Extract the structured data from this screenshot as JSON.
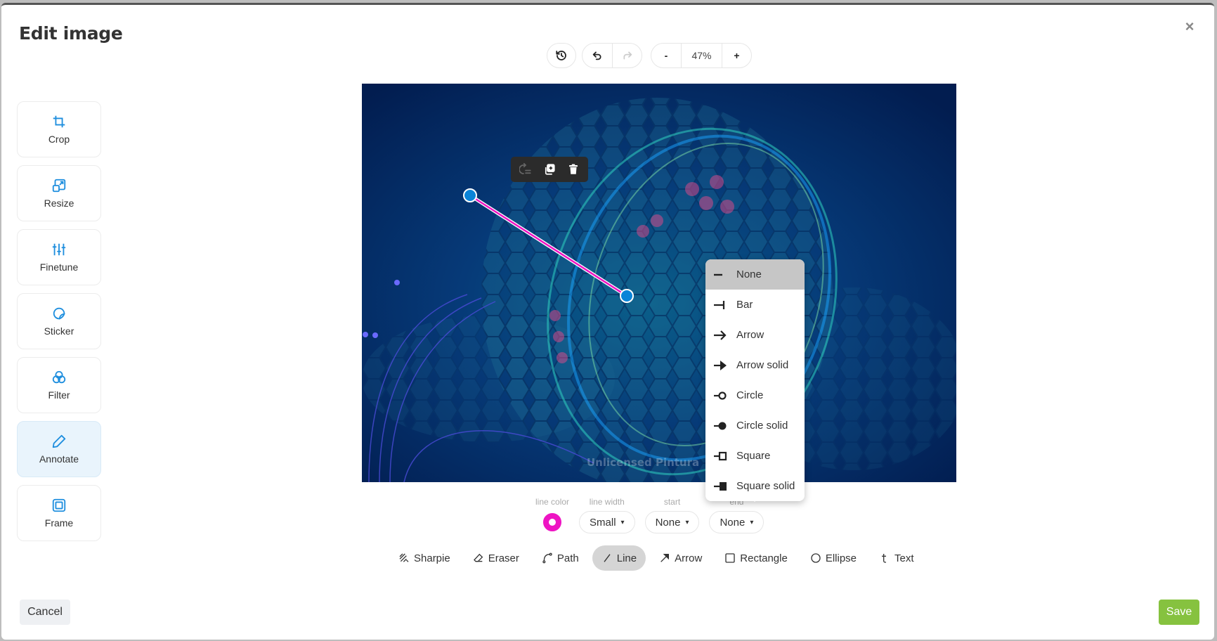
{
  "dialog": {
    "title": "Edit image",
    "close_label": "×"
  },
  "history": {
    "revert_icon": "history-icon",
    "undo_icon": "undo-icon",
    "redo_icon": "redo-icon",
    "redo_enabled": false
  },
  "zoom": {
    "decrease_label": "-",
    "value": "47%",
    "increase_label": "+"
  },
  "sidebar": {
    "items": [
      {
        "label": "Crop",
        "icon": "crop-icon",
        "active": false
      },
      {
        "label": "Resize",
        "icon": "resize-icon",
        "active": false
      },
      {
        "label": "Finetune",
        "icon": "sliders-icon",
        "active": false
      },
      {
        "label": "Sticker",
        "icon": "sticker-icon",
        "active": false
      },
      {
        "label": "Filter",
        "icon": "filter-icon",
        "active": false
      },
      {
        "label": "Annotate",
        "icon": "pencil-icon",
        "active": true
      },
      {
        "label": "Frame",
        "icon": "frame-icon",
        "active": false
      }
    ]
  },
  "canvas": {
    "watermark": "Unlicensed Pintura",
    "line_color": "#ee14c3",
    "handle_color": "#0a84d8",
    "shape_toolbar": {
      "icons": [
        "send-to-back-icon",
        "duplicate-icon",
        "trash-icon"
      ]
    }
  },
  "end_dropdown": {
    "options": [
      {
        "label": "None",
        "icon": "line-end-none-icon",
        "selected": true
      },
      {
        "label": "Bar",
        "icon": "line-end-bar-icon",
        "selected": false
      },
      {
        "label": "Arrow",
        "icon": "line-end-arrow-icon",
        "selected": false
      },
      {
        "label": "Arrow solid",
        "icon": "line-end-arrow-solid-icon",
        "selected": false
      },
      {
        "label": "Circle",
        "icon": "line-end-circle-icon",
        "selected": false
      },
      {
        "label": "Circle solid",
        "icon": "line-end-circle-solid-icon",
        "selected": false
      },
      {
        "label": "Square",
        "icon": "line-end-square-icon",
        "selected": false
      },
      {
        "label": "Square solid",
        "icon": "line-end-square-solid-icon",
        "selected": false
      }
    ]
  },
  "properties": {
    "line_color_label": "line color",
    "line_color_value": "#ee14c3",
    "line_width_label": "line width",
    "line_width_value": "Small",
    "start_label": "start",
    "start_value": "None",
    "end_label": "end",
    "end_value": "None",
    "caret": "▾"
  },
  "shapes": {
    "items": [
      {
        "label": "Sharpie",
        "icon": "sharpie-icon",
        "active": false
      },
      {
        "label": "Eraser",
        "icon": "eraser-icon",
        "active": false
      },
      {
        "label": "Path",
        "icon": "path-icon",
        "active": false
      },
      {
        "label": "Line",
        "icon": "line-icon",
        "active": true
      },
      {
        "label": "Arrow",
        "icon": "arrow-icon",
        "active": false
      },
      {
        "label": "Rectangle",
        "icon": "rectangle-icon",
        "active": false
      },
      {
        "label": "Ellipse",
        "icon": "ellipse-icon",
        "active": false
      },
      {
        "label": "Text",
        "icon": "text-icon",
        "active": false
      }
    ]
  },
  "footer": {
    "cancel_label": "Cancel",
    "save_label": "Save",
    "save_color": "#86c23f"
  }
}
